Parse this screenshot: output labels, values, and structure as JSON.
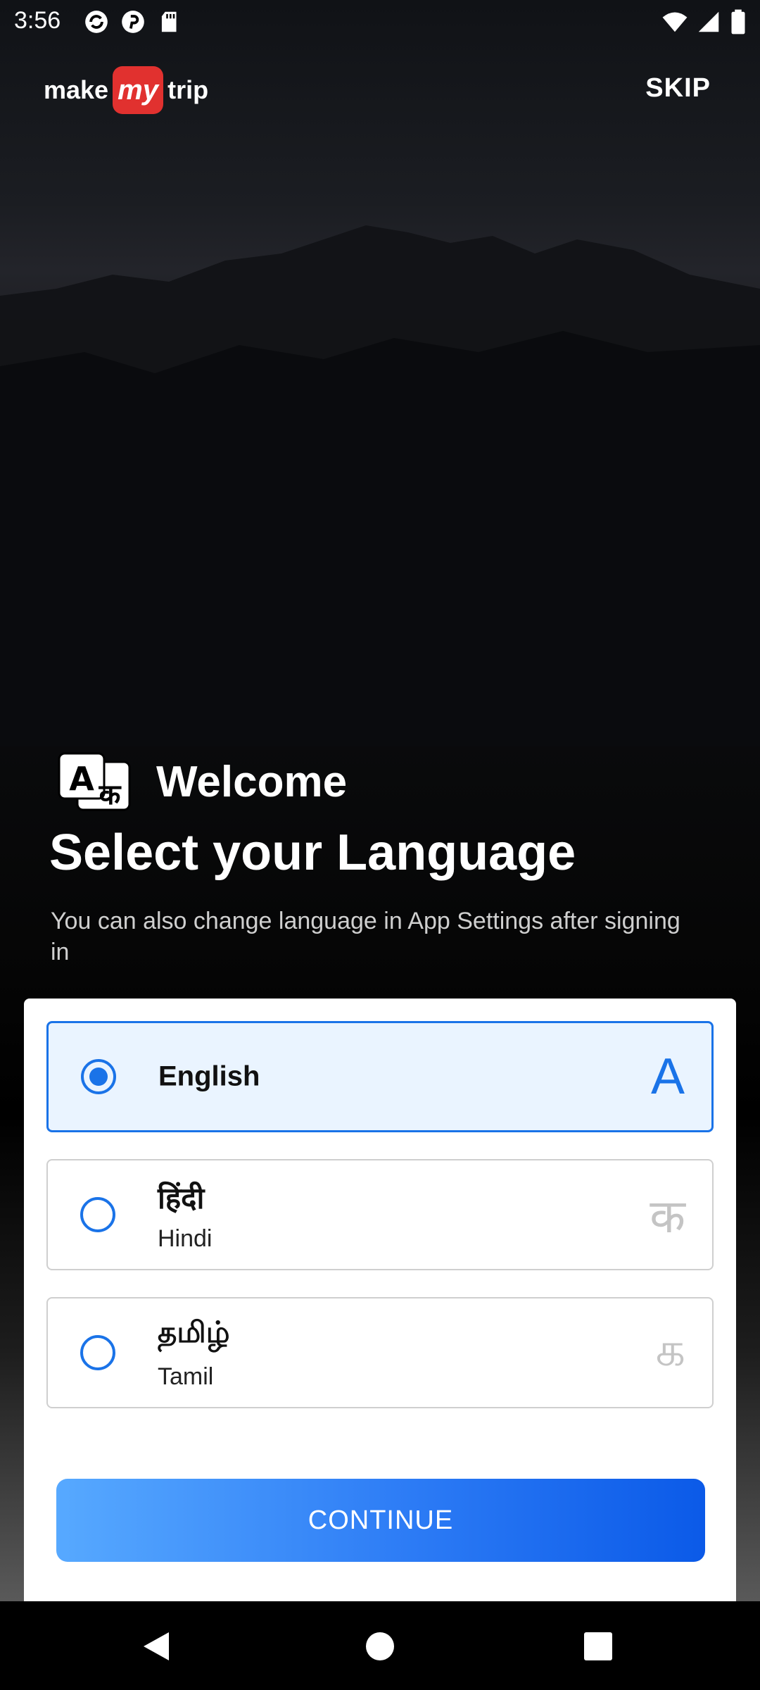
{
  "status_bar": {
    "time": "3:56",
    "left_icons": [
      "sync-icon",
      "pinterest-icon",
      "sd-card-icon"
    ],
    "right_icons": [
      "wifi-icon",
      "signal-icon",
      "battery-icon"
    ]
  },
  "header": {
    "brand": {
      "make": "make",
      "my": "my",
      "trip": "trip"
    },
    "skip_label": "SKIP"
  },
  "welcome": {
    "icon": "language-translate-icon",
    "icon_text_latin": "A",
    "icon_text_hindi": "क",
    "greeting": "Welcome",
    "title": "Select your Language",
    "subtitle": "You can also change language in App Settings after signing in"
  },
  "languages": [
    {
      "native": "English",
      "english": "",
      "glyph": "A",
      "selected": true
    },
    {
      "native": "हिंदी",
      "english": "Hindi",
      "glyph": "क",
      "selected": false
    },
    {
      "native": "தமிழ்",
      "english": "Tamil",
      "glyph": "க",
      "selected": false
    }
  ],
  "continue_label": "CONTINUE",
  "colors": {
    "accent": "#1a73e8",
    "brand_red": "#e1312f",
    "selected_bg": "#eaf4ff"
  },
  "nav_bar": {
    "icons": [
      "back-icon",
      "home-icon",
      "recents-icon"
    ]
  }
}
